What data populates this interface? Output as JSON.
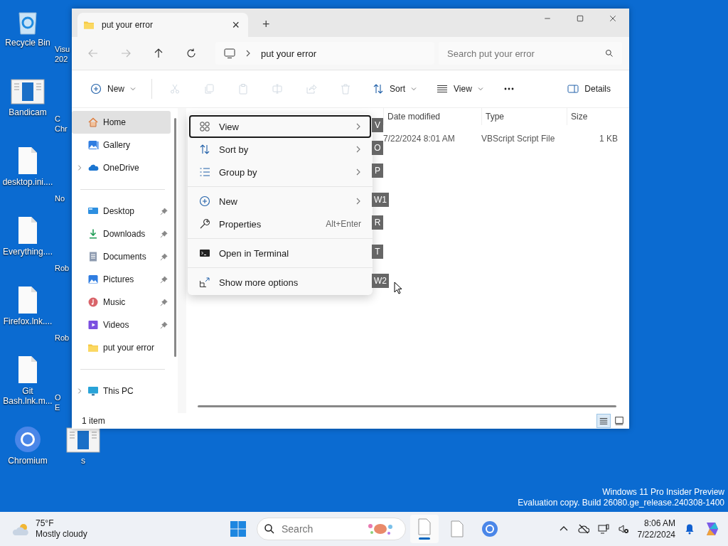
{
  "desktop_icons": [
    {
      "label": "Recycle Bin",
      "kind": "recycle"
    },
    {
      "label": "Bandicam",
      "kind": "app"
    },
    {
      "label": "desktop.ini....",
      "kind": "file"
    },
    {
      "label": "Everything....",
      "kind": "file"
    },
    {
      "label": "Firefox.lnk....",
      "kind": "file"
    },
    {
      "label": "Git\nBash.lnk.m...",
      "kind": "file"
    },
    {
      "label": "Chromium",
      "kind": "chromium"
    },
    {
      "label": "Visu\n202",
      "kind": "covered"
    },
    {
      "label": "C\nChr",
      "kind": "covered"
    },
    {
      "label": "No",
      "kind": "covered"
    },
    {
      "label": "Rob",
      "kind": "covered"
    },
    {
      "label": "Rob",
      "kind": "covered"
    },
    {
      "label": "O\nE",
      "kind": "covered"
    },
    {
      "label": "s",
      "kind": "app"
    }
  ],
  "window": {
    "tab": {
      "title": "put your error",
      "close": "×"
    },
    "new_tab": "+",
    "address": {
      "crumb": "put your error"
    },
    "search": {
      "placeholder": "Search put your error"
    },
    "toolbar": [
      {
        "kind": "new",
        "label": "New",
        "caret": true,
        "disabled": false
      },
      {
        "kind": "cut",
        "disabled": true
      },
      {
        "kind": "copy",
        "disabled": true
      },
      {
        "kind": "paste",
        "disabled": true
      },
      {
        "kind": "rename",
        "disabled": true
      },
      {
        "kind": "share",
        "disabled": true
      },
      {
        "kind": "delete",
        "disabled": true
      },
      {
        "kind": "sort",
        "label": "Sort",
        "caret": true,
        "disabled": false
      },
      {
        "kind": "view",
        "label": "View",
        "caret": true,
        "disabled": false
      },
      {
        "kind": "more",
        "disabled": false
      },
      {
        "kind": "details",
        "label": "Details",
        "disabled": false
      }
    ],
    "sidebar": {
      "groups": [
        [
          {
            "label": "Home",
            "kind": "home",
            "selected": true,
            "expandable": false,
            "pinned": false
          },
          {
            "label": "Gallery",
            "kind": "gallery",
            "selected": false,
            "expandable": false,
            "pinned": false
          },
          {
            "label": "OneDrive",
            "kind": "cloud",
            "selected": false,
            "expandable": true,
            "pinned": false
          }
        ],
        [
          {
            "label": "Desktop",
            "kind": "desktop",
            "selected": false,
            "expandable": false,
            "pinned": true
          },
          {
            "label": "Downloads",
            "kind": "download",
            "selected": false,
            "expandable": false,
            "pinned": true
          },
          {
            "label": "Documents",
            "kind": "document",
            "selected": false,
            "expandable": false,
            "pinned": true
          },
          {
            "label": "Pictures",
            "kind": "picture",
            "selected": false,
            "expandable": false,
            "pinned": true
          },
          {
            "label": "Music",
            "kind": "music",
            "selected": false,
            "expandable": false,
            "pinned": true
          },
          {
            "label": "Videos",
            "kind": "video",
            "selected": false,
            "expandable": false,
            "pinned": true
          },
          {
            "label": "put your error",
            "kind": "folder",
            "selected": false,
            "expandable": false,
            "pinned": false
          }
        ],
        [
          {
            "label": "This PC",
            "kind": "pc",
            "selected": false,
            "expandable": true,
            "pinned": false
          }
        ]
      ]
    },
    "table": {
      "columns": [
        "Date modified",
        "Type",
        "Size"
      ],
      "rows": [
        [
          "7/22/2024 8:01 AM",
          "VBScript Script File",
          "1 KB"
        ]
      ]
    },
    "context_menu": {
      "groups": [
        [
          {
            "label": "View",
            "kind": "grid",
            "submenu": true,
            "selected": true,
            "access_key": "V"
          },
          {
            "label": "Sort by",
            "kind": "sort",
            "submenu": true,
            "selected": false,
            "access_key": "O"
          },
          {
            "label": "Group by",
            "kind": "list",
            "submenu": true,
            "selected": false,
            "access_key": "P"
          }
        ],
        [
          {
            "label": "New",
            "kind": "plus",
            "submenu": true,
            "selected": false,
            "access_key": "W1"
          },
          {
            "label": "Properties",
            "kind": "wrench",
            "submenu": false,
            "selected": false,
            "shortcut": "Alt+Enter",
            "access_key": "R"
          }
        ],
        [
          {
            "label": "Open in Terminal",
            "kind": "terminal",
            "submenu": false,
            "selected": false,
            "access_key": "T"
          }
        ],
        [
          {
            "label": "Show more options",
            "kind": "more",
            "submenu": false,
            "selected": false,
            "access_key": "W2"
          }
        ]
      ]
    },
    "status_bar": {
      "count": "1 item",
      "views": [
        {
          "kind": "details",
          "selected": true
        },
        {
          "kind": "tiles",
          "selected": false
        }
      ]
    }
  },
  "watermark": [
    "Windows 11 Pro Insider Preview",
    "Evaluation copy. Build 26080.ge_release.240308-1400"
  ],
  "taskbar": {
    "weather": {
      "temp": "75°F",
      "condition": "Mostly cloudy"
    },
    "search": {
      "placeholder": "Search"
    },
    "apps": [
      {
        "kind": "file",
        "selected": true
      },
      {
        "kind": "file",
        "selected": false
      },
      {
        "kind": "chromium",
        "selected": false
      }
    ],
    "clock": {
      "time": "8:06 AM",
      "date": "7/22/2024"
    }
  }
}
